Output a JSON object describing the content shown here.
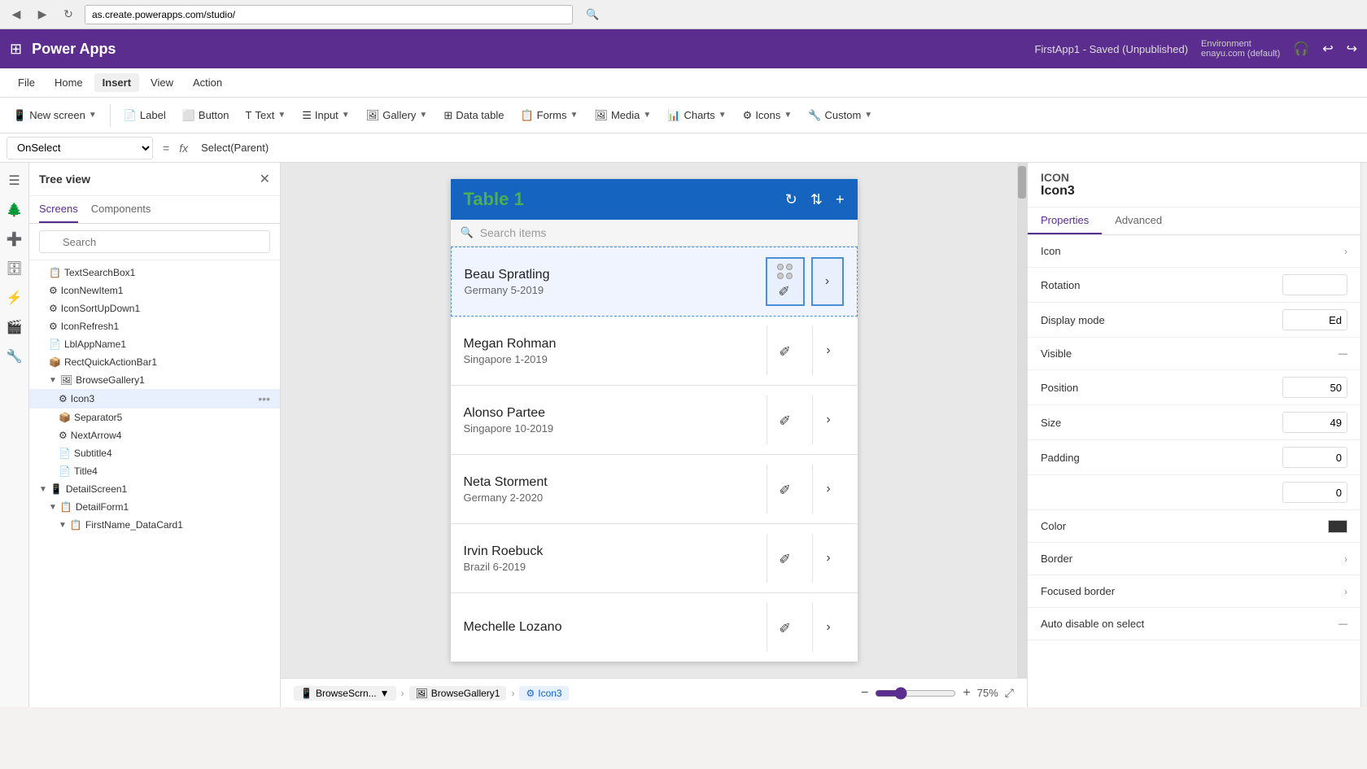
{
  "browser": {
    "back_label": "◀",
    "forward_label": "▶",
    "refresh_label": "↻",
    "url": "as.create.powerapps.com/studio/",
    "search_icon": "🔍"
  },
  "app_header": {
    "grid_icon": "⊞",
    "title": "Power Apps",
    "saved_text": "FirstApp1 - Saved (Unpublished)",
    "env_label": "Environment",
    "env_name": "enayu.com (default)"
  },
  "menu": {
    "items": [
      {
        "label": "File",
        "active": false
      },
      {
        "label": "Home",
        "active": false
      },
      {
        "label": "Insert",
        "active": true
      },
      {
        "label": "View",
        "active": false
      },
      {
        "label": "Action",
        "active": false
      }
    ]
  },
  "toolbar": {
    "new_screen_label": "New screen",
    "label_label": "Label",
    "button_label": "Button",
    "text_label": "Text",
    "input_label": "Input",
    "gallery_label": "Gallery",
    "data_table_label": "Data table",
    "forms_label": "Forms",
    "media_label": "Media",
    "charts_label": "Charts",
    "icons_label": "Icons",
    "custom_label": "Custom"
  },
  "formula_bar": {
    "select_value": "OnSelect",
    "equals": "=",
    "fx": "fx",
    "formula": "Select(Parent)"
  },
  "tree_view": {
    "title": "Tree view",
    "tabs": [
      "Screens",
      "Components"
    ],
    "active_tab": "Screens",
    "search_placeholder": "Search",
    "items": [
      {
        "label": "TextSearchBox1",
        "indent": 1,
        "icon": "📋",
        "selected": false
      },
      {
        "label": "IconNewItem1",
        "indent": 1,
        "icon": "⚙",
        "selected": false
      },
      {
        "label": "IconSortUpDown1",
        "indent": 1,
        "icon": "⚙",
        "selected": false
      },
      {
        "label": "IconRefresh1",
        "indent": 1,
        "icon": "⚙",
        "selected": false
      },
      {
        "label": "LblAppName1",
        "indent": 1,
        "icon": "📄",
        "selected": false
      },
      {
        "label": "RectQuickActionBar1",
        "indent": 1,
        "icon": "📦",
        "selected": false
      },
      {
        "label": "BrowseGallery1",
        "indent": 1,
        "icon": "🖼",
        "selected": false,
        "expanded": true
      },
      {
        "label": "Icon3",
        "indent": 2,
        "icon": "⚙",
        "selected": true
      },
      {
        "label": "Separator5",
        "indent": 2,
        "icon": "📦",
        "selected": false
      },
      {
        "label": "NextArrow4",
        "indent": 2,
        "icon": "⚙",
        "selected": false
      },
      {
        "label": "Subtitle4",
        "indent": 2,
        "icon": "📄",
        "selected": false
      },
      {
        "label": "Title4",
        "indent": 2,
        "icon": "📄",
        "selected": false
      },
      {
        "label": "DetailScreen1",
        "indent": 0,
        "icon": "📱",
        "selected": false,
        "expanded": true
      },
      {
        "label": "DetailForm1",
        "indent": 1,
        "icon": "📋",
        "selected": false,
        "expanded": true
      },
      {
        "label": "FirstName_DataCard1",
        "indent": 2,
        "icon": "📋",
        "selected": false
      }
    ]
  },
  "canvas": {
    "app_title": "Table 1",
    "search_placeholder": "Search items",
    "gallery_items": [
      {
        "name": "Beau Spratling",
        "sub": "Germany 5-2019",
        "selected": true
      },
      {
        "name": "Megan Rohman",
        "sub": "Singapore 1-2019",
        "selected": false
      },
      {
        "name": "Alonso Partee",
        "sub": "Singapore 10-2019",
        "selected": false
      },
      {
        "name": "Neta Storment",
        "sub": "Germany 2-2020",
        "selected": false
      },
      {
        "name": "Irvin Roebuck",
        "sub": "Brazil 6-2019",
        "selected": false
      },
      {
        "name": "Mechelle Lozano",
        "sub": "",
        "selected": false
      }
    ]
  },
  "right_panel": {
    "icon_label": "ICON",
    "icon_name": "Icon3",
    "tabs": [
      "Properties",
      "Advanced"
    ],
    "active_tab": "Properties",
    "properties": [
      {
        "label": "Icon",
        "value": "",
        "type": "chevron"
      },
      {
        "label": "Rotation",
        "value": "",
        "type": "input"
      },
      {
        "label": "Display mode",
        "value": "Ed",
        "type": "input_text"
      },
      {
        "label": "Visible",
        "value": "",
        "type": "toggle"
      },
      {
        "label": "Position",
        "value": "50",
        "type": "input"
      },
      {
        "label": "Size",
        "value": "49",
        "type": "input"
      },
      {
        "label": "Padding",
        "value": "0",
        "type": "input"
      },
      {
        "label": "",
        "value": "0",
        "type": "input"
      },
      {
        "label": "Color",
        "value": "",
        "type": "color"
      },
      {
        "label": "Border",
        "value": "",
        "type": "chevron"
      },
      {
        "label": "Focused border",
        "value": "",
        "type": "chevron"
      },
      {
        "label": "Auto disable on select",
        "value": "",
        "type": "toggle"
      }
    ]
  },
  "bottom_bar": {
    "breadcrumbs": [
      {
        "label": "BrowseScrn...",
        "icon": "📱",
        "active": false
      },
      {
        "label": "BrowseGallery1",
        "icon": "🖼",
        "active": false
      },
      {
        "label": "Icon3",
        "icon": "⚙",
        "active": true
      }
    ],
    "zoom_minus": "−",
    "zoom_plus": "+",
    "zoom_value": "75",
    "zoom_unit": "%",
    "expand_icon": "⤢"
  }
}
